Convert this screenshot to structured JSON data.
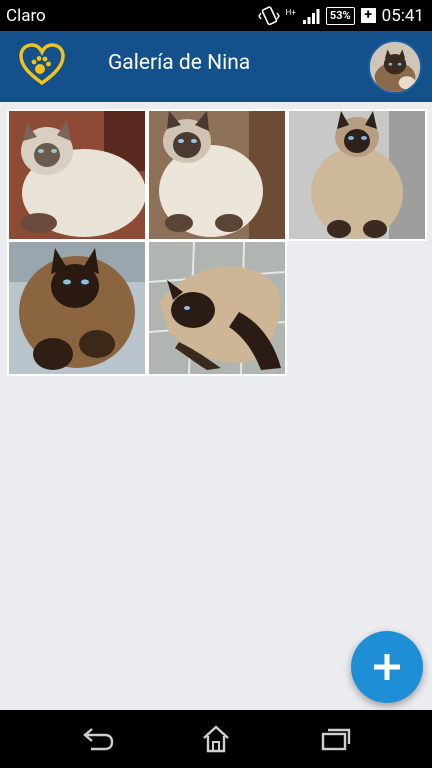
{
  "status_bar": {
    "carrier": "Claro",
    "network": "H+",
    "battery_percent": "53%",
    "time": "05:41"
  },
  "app_bar": {
    "title": "Galería de Nina",
    "logo": "heart-paw-icon",
    "profile": "avatar-photo"
  },
  "gallery": {
    "photos": [
      {
        "name": "photo-1"
      },
      {
        "name": "photo-2"
      },
      {
        "name": "photo-3"
      },
      {
        "name": "photo-4"
      },
      {
        "name": "photo-5"
      }
    ]
  },
  "fab": {
    "icon": "plus-icon"
  },
  "nav_bar": {
    "items": [
      "back-icon",
      "home-icon",
      "recents-icon"
    ]
  },
  "colors": {
    "app_bar": "#13508c",
    "accent": "#1e8fd6",
    "logo": "#f2c21b",
    "background": "#ebecef"
  }
}
